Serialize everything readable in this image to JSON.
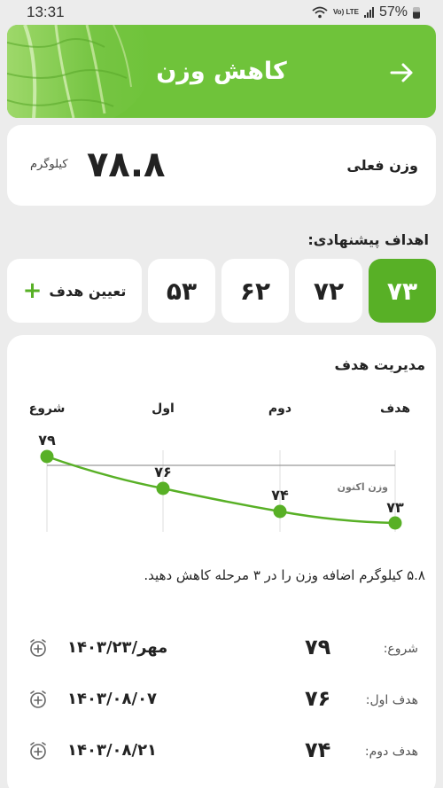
{
  "status": {
    "time": "13:31",
    "battery": "57%",
    "network": "Vo) LTE"
  },
  "header": {
    "title": "کاهش وزن",
    "color": "#6fc33a"
  },
  "current_weight": {
    "label": "وزن فعلی",
    "value": "۷۸.۸",
    "unit": "کیلوگرم"
  },
  "goals": {
    "label": "اهداف پیشنهادی:",
    "options": [
      "۷۳",
      "۷۲",
      "۶۲",
      "۵۳"
    ],
    "active_index": 0,
    "set_goal_label": "تعیین هدف",
    "accent": "#58b026"
  },
  "manage": {
    "title": "مدیریت هدف",
    "stages": [
      "شروع",
      "اول",
      "دوم",
      "هدف"
    ],
    "points": [
      "۷۹",
      "۷۶",
      "۷۴",
      "۷۳"
    ],
    "current_label": "وزن اکنون",
    "summary": "۵.۸ کیلوگرم اضافه وزن را در ۳ مرحله کاهش دهید."
  },
  "milestones": [
    {
      "label": "شروع:",
      "value": "۷۹",
      "date": "۱۴۰۳/مهر/۲۳"
    },
    {
      "label": "هدف اول:",
      "value": "۷۶",
      "date": "۱۴۰۳/۰۸/۰۷"
    },
    {
      "label": "هدف دوم:",
      "value": "۷۴",
      "date": "۱۴۰۳/۰۸/۲۱"
    }
  ]
}
